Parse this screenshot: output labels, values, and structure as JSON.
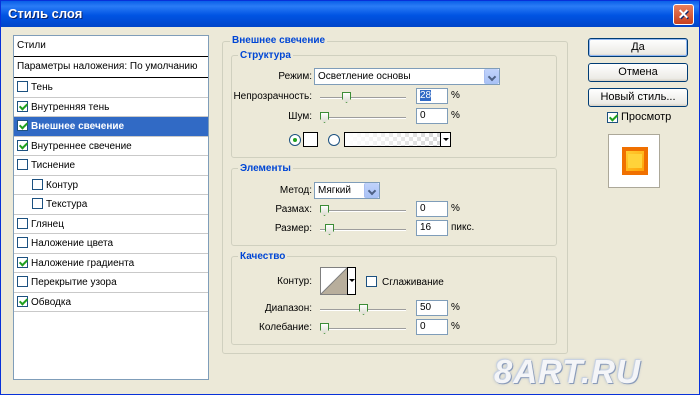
{
  "window": {
    "title": "Стиль слоя",
    "close_glyph": "✕"
  },
  "styles_panel": {
    "header": "Стили",
    "blend_options": "Параметры наложения: По умолчанию",
    "items": [
      {
        "label": "Тень",
        "checked": false,
        "indent": false,
        "selected": false
      },
      {
        "label": "Внутренняя тень",
        "checked": true,
        "indent": false,
        "selected": false
      },
      {
        "label": "Внешнее свечение",
        "checked": true,
        "indent": false,
        "selected": true
      },
      {
        "label": "Внутреннее свечение",
        "checked": true,
        "indent": false,
        "selected": false
      },
      {
        "label": "Тиснение",
        "checked": false,
        "indent": false,
        "selected": false
      },
      {
        "label": "Контур",
        "checked": false,
        "indent": true,
        "selected": false
      },
      {
        "label": "Текстура",
        "checked": false,
        "indent": true,
        "selected": false
      },
      {
        "label": "Глянец",
        "checked": false,
        "indent": false,
        "selected": false
      },
      {
        "label": "Наложение цвета",
        "checked": false,
        "indent": false,
        "selected": false
      },
      {
        "label": "Наложение градиента",
        "checked": true,
        "indent": false,
        "selected": false
      },
      {
        "label": "Перекрытие узора",
        "checked": false,
        "indent": false,
        "selected": false
      },
      {
        "label": "Обводка",
        "checked": true,
        "indent": false,
        "selected": false
      }
    ]
  },
  "outer_glow": {
    "title": "Внешнее свечение",
    "structure": {
      "title": "Структура",
      "mode_label": "Режим:",
      "mode_value": "Осветление основы",
      "opacity_label": "Непрозрачность:",
      "opacity_value": "28",
      "opacity_unit": "%",
      "opacity_level": 0.28,
      "noise_label": "Шум:",
      "noise_value": "0",
      "noise_unit": "%",
      "noise_level": 0,
      "color_mode": "solid"
    },
    "elements": {
      "title": "Элементы",
      "method_label": "Метод:",
      "method_value": "Мягкий",
      "spread_label": "Размах:",
      "spread_value": "0",
      "spread_unit": "%",
      "spread_level": 0,
      "size_label": "Размер:",
      "size_value": "16",
      "size_unit": "пикс.",
      "size_level": 0.064
    },
    "quality": {
      "title": "Качество",
      "contour_label": "Контур:",
      "antialias_label": "Сглаживание",
      "antialias_checked": false,
      "range_label": "Диапазон:",
      "range_value": "50",
      "range_unit": "%",
      "range_level": 0.5,
      "jitter_label": "Колебание:",
      "jitter_value": "0",
      "jitter_unit": "%",
      "jitter_level": 0
    }
  },
  "buttons": {
    "ok": "Да",
    "cancel": "Отмена",
    "new_style": "Новый стиль...",
    "preview_label": "Просмотр",
    "preview_checked": true
  },
  "watermark": "8ART.RU",
  "colors": {
    "title_bar": "#0054e3",
    "selection": "#316ac5",
    "group_title": "#0046d5",
    "preview_glow": "#ff9a00"
  }
}
